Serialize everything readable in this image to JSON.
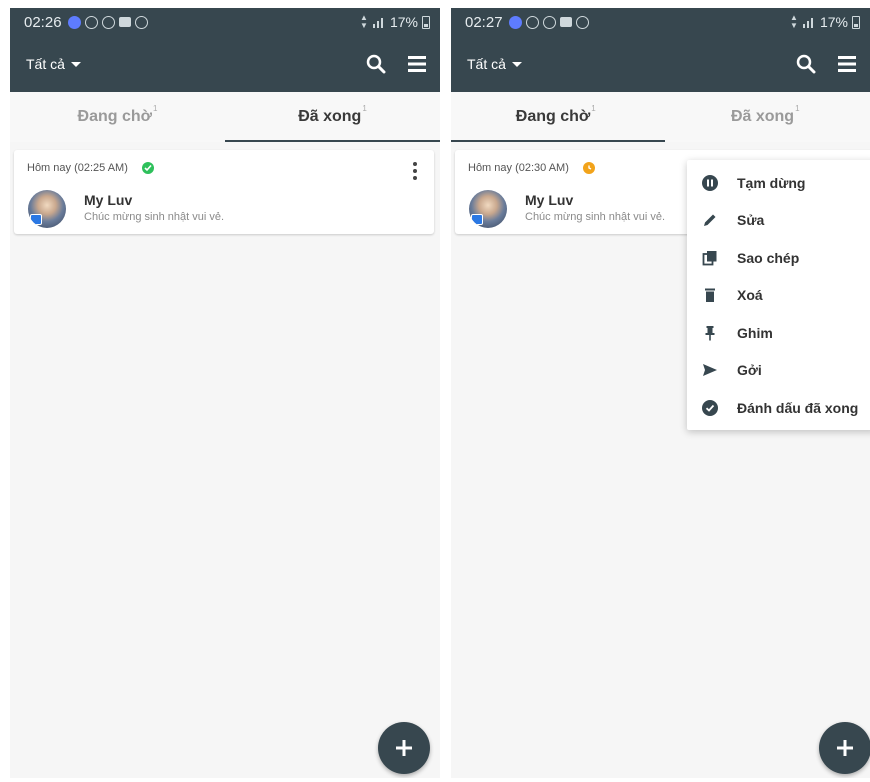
{
  "left": {
    "status": {
      "time": "02:26",
      "battery": "17%"
    },
    "toolbar": {
      "filter": "Tất cả"
    },
    "tabs": [
      {
        "label": "Đang chờ",
        "count": "1"
      },
      {
        "label": "Đã xong",
        "count": "1"
      }
    ],
    "active_tab": 1,
    "card": {
      "when": "Hôm nay (02:25 AM)",
      "name": "My Luv",
      "message": "Chúc mừng sinh nhật vui vẻ.",
      "state": "done"
    }
  },
  "right": {
    "status": {
      "time": "02:27",
      "battery": "17%"
    },
    "toolbar": {
      "filter": "Tất cả"
    },
    "tabs": [
      {
        "label": "Đang chờ",
        "count": "1"
      },
      {
        "label": "Đã xong",
        "count": "1"
      }
    ],
    "active_tab": 0,
    "card": {
      "when": "Hôm nay (02:30 AM)",
      "name": "My Luv",
      "message": "Chúc mừng sinh nhật vui vẻ.",
      "state": "waiting"
    },
    "menu": [
      {
        "label": "Tạm dừng",
        "icon": "pause-icon"
      },
      {
        "label": "Sửa",
        "icon": "edit-icon"
      },
      {
        "label": "Sao chép",
        "icon": "copy-icon"
      },
      {
        "label": "Xoá",
        "icon": "delete-icon"
      },
      {
        "label": "Ghim",
        "icon": "pin-icon"
      },
      {
        "label": "Gởi",
        "icon": "send-icon"
      },
      {
        "label": "Đánh dấu đã xong",
        "icon": "check-circle-icon"
      }
    ]
  },
  "colors": {
    "primary": "#37474f",
    "done": "#2ec05b",
    "waiting": "#f2a31a"
  }
}
